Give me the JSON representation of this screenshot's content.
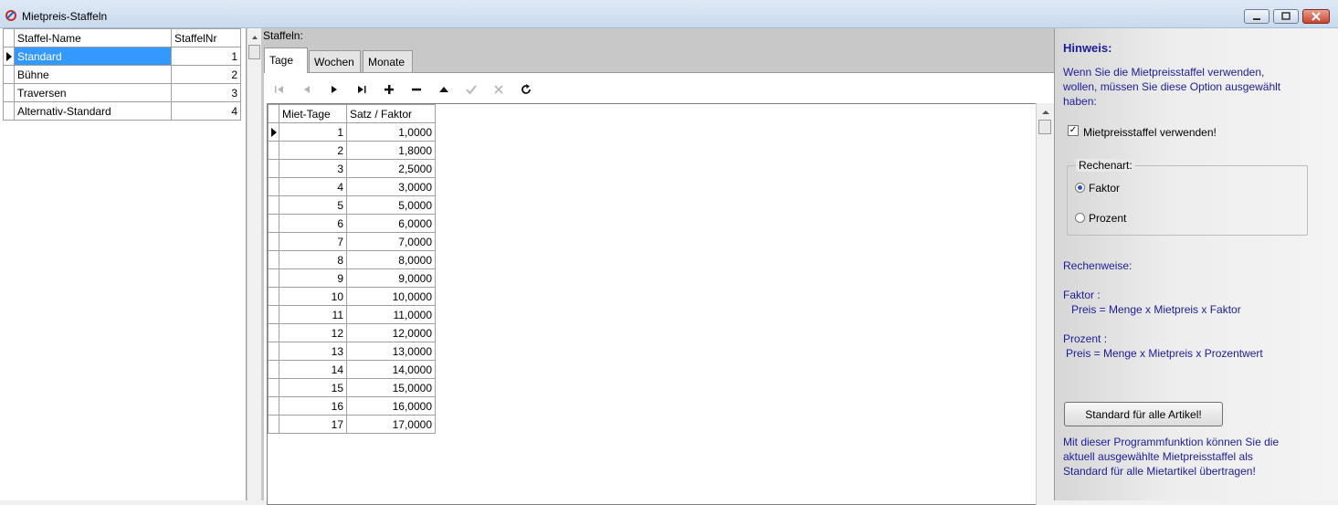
{
  "window": {
    "title": "Mietpreis-Staffeln",
    "minimize_label": "–",
    "maximize_label": "□",
    "close_label": "✕"
  },
  "staffel_grid": {
    "headers": [
      "Staffel-Name",
      "StaffelNr"
    ],
    "rows": [
      {
        "name": "Standard",
        "nr": "1"
      },
      {
        "name": "Bühne",
        "nr": "2"
      },
      {
        "name": "Traversen",
        "nr": "3"
      },
      {
        "name": "Alternativ-Standard",
        "nr": "4"
      }
    ],
    "selected_index": 0
  },
  "staffeln": {
    "label": "Staffeln:",
    "tabs": [
      "Tage",
      "Wochen",
      "Monate"
    ],
    "active_tab": "Tage",
    "toolbar_icons": [
      "first-icon",
      "prior-icon",
      "next-icon",
      "last-icon",
      "insert-icon",
      "delete-icon",
      "edit-icon",
      "post-icon",
      "cancel-icon",
      "refresh-icon"
    ],
    "grid_headers": [
      "Miet-Tage",
      "Satz / Faktor"
    ],
    "grid_rows": [
      [
        "1",
        "1,0000"
      ],
      [
        "2",
        "1,8000"
      ],
      [
        "3",
        "2,5000"
      ],
      [
        "4",
        "3,0000"
      ],
      [
        "5",
        "5,0000"
      ],
      [
        "6",
        "6,0000"
      ],
      [
        "7",
        "7,0000"
      ],
      [
        "8",
        "8,0000"
      ],
      [
        "9",
        "9,0000"
      ],
      [
        "10",
        "10,0000"
      ],
      [
        "11",
        "11,0000"
      ],
      [
        "12",
        "12,0000"
      ],
      [
        "13",
        "13,0000"
      ],
      [
        "14",
        "14,0000"
      ],
      [
        "15",
        "15,0000"
      ],
      [
        "16",
        "16,0000"
      ],
      [
        "17",
        "17,0000"
      ]
    ]
  },
  "hinweis": {
    "title": "Hinweis:",
    "line1": "Wenn Sie die Mietpreisstaffel verwenden,",
    "line2": "wollen, müssen Sie diese Option ausgewählt",
    "line3": "haben:",
    "checkbox_label": "Mietpreisstaffel verwenden!",
    "checkbox_checked": true,
    "rechenart_legend": "Rechenart:",
    "radio_faktor": "Faktor",
    "radio_prozent": "Prozent",
    "radio_selected": "Faktor",
    "rechenweise": "Rechenweise:",
    "faktor_label": "Faktor :",
    "faktor_formula": "Preis = Menge x Mietpreis x Faktor",
    "prozent_label": "Prozent :",
    "prozent_formula": "Preis = Menge x Mietpreis x Prozentwert",
    "button_label": "Standard für alle Artikel!",
    "desc1": "Mit dieser Programmfunktion können Sie die",
    "desc2": "aktuell ausgewählte Mietpreisstaffel als",
    "desc3": "Standard für alle Mietartikel übertragen!"
  },
  "colors": {
    "selection": "#3399ff",
    "info_text": "#1c1c9c",
    "title_gradient_top": "#dfe9f5"
  }
}
